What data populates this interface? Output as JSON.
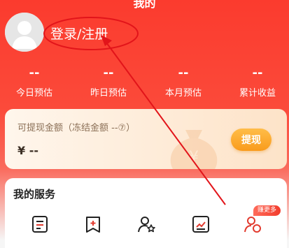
{
  "header": {
    "title": "我的",
    "login_text": "登录/注册"
  },
  "stats": [
    {
      "value": "--",
      "label": "今日预估"
    },
    {
      "value": "--",
      "label": "昨日预估"
    },
    {
      "value": "--",
      "label": "本月预估"
    },
    {
      "value": "--",
      "label": "累计收益"
    }
  ],
  "wallet": {
    "title": "可提现金额（冻结金额 --⑦）",
    "amount": "¥ --",
    "withdraw_label": "提现"
  },
  "services": {
    "title": "我的服务",
    "badge": "赚更多",
    "icons": [
      "document-list-icon",
      "bookmark-add-icon",
      "user-star-icon",
      "trend-chart-icon",
      "user-coin-icon"
    ]
  },
  "colors": {
    "header_red": "#fb3b2e",
    "annotation_red": "#e2141a",
    "withdraw_orange": "#f99b1c"
  }
}
